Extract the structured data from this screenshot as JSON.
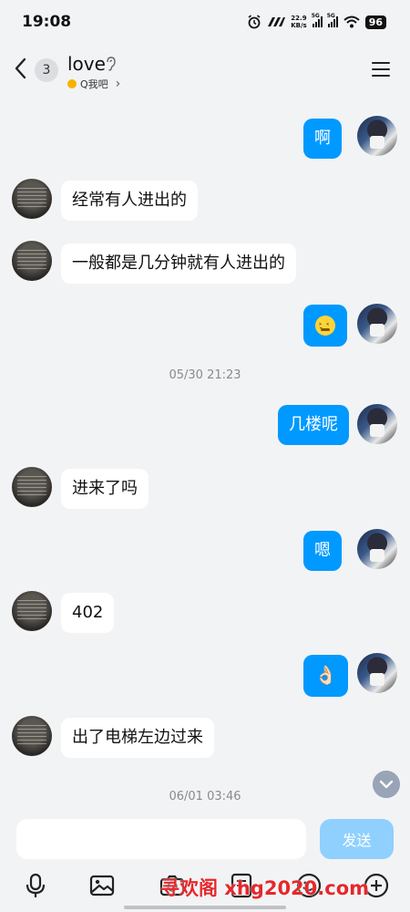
{
  "status_bar": {
    "time": "19:08",
    "net_speed_value": "22.9",
    "net_speed_unit": "KB/s",
    "sim1": "5G",
    "sim2": "5G",
    "battery": "96"
  },
  "header": {
    "unread_count": "3",
    "title": "love",
    "subtitle": "Q我吧",
    "subtitle_chevron": "›"
  },
  "messages": [
    {
      "side": "out",
      "text": "啊"
    },
    {
      "side": "in",
      "text": "经常有人进出的"
    },
    {
      "side": "in",
      "text": "一般都是几分钟就有人进出的"
    },
    {
      "side": "out",
      "emoji": "face-emoji"
    },
    {
      "type": "time",
      "text": "05/30 21:23"
    },
    {
      "side": "out",
      "text": "几楼呢"
    },
    {
      "side": "in",
      "text": "进来了吗"
    },
    {
      "side": "out",
      "text": "嗯"
    },
    {
      "side": "in",
      "text": "402"
    },
    {
      "side": "out",
      "text": "👌🏻"
    },
    {
      "side": "in",
      "text": "出了电梯左边过来"
    },
    {
      "type": "time",
      "text": "06/01 03:46"
    }
  ],
  "composer": {
    "input_value": "",
    "send_label": "发送"
  },
  "toolbar_icons": [
    "microphone-icon",
    "image-icon",
    "camera-icon",
    "file-icon",
    "emoji-icon",
    "plus-icon"
  ],
  "watermark": "寻欢阁 xhg2020.com",
  "colors": {
    "outgoing_bubble": "#0099ff",
    "incoming_bubble": "#ffffff",
    "background": "#f2f3f5",
    "send_button": "#8fd0ff",
    "watermark": "#e5282b"
  }
}
